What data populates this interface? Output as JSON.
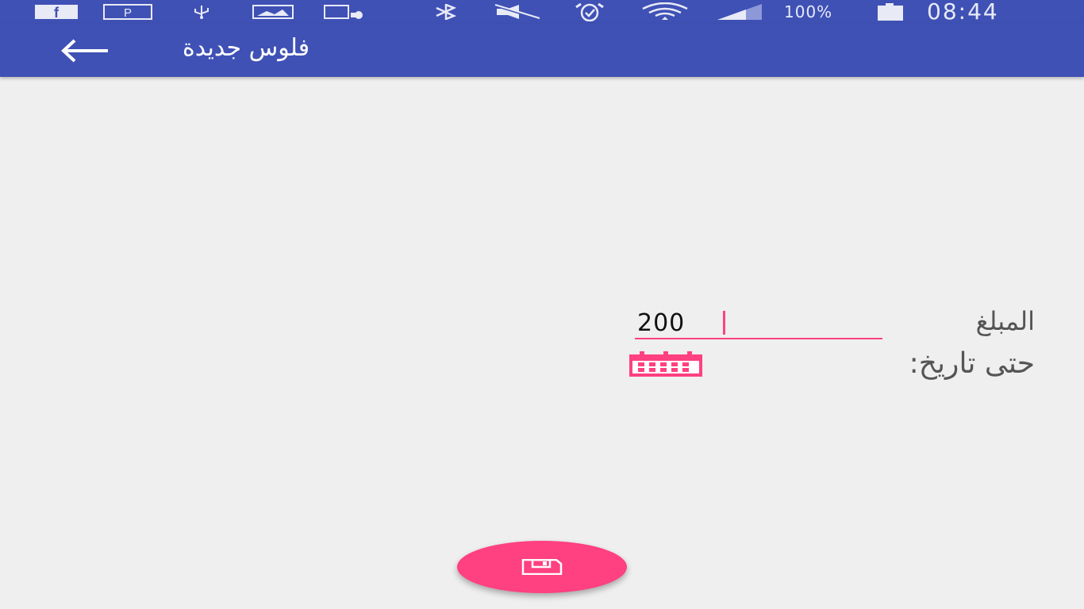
{
  "status_bar": {
    "battery_percent": "100%",
    "time": "08:44",
    "icons": [
      "facebook-icon",
      "pinterest-icon",
      "usb-icon",
      "image-icon",
      "cast-icon",
      "bluetooth-icon",
      "mute-icon",
      "alarm-icon",
      "wifi-icon",
      "signal-icon",
      "battery-icon"
    ]
  },
  "app_bar": {
    "title": "فلوس جديدة",
    "back_icon": "arrow-left-icon"
  },
  "form": {
    "amount_label": "المبلغ",
    "amount_value": "200",
    "date_label": "حتى تاريخ:",
    "calendar_icon": "calendar-icon"
  },
  "fab": {
    "icon": "save-icon"
  },
  "colors": {
    "primary": "#3f51b5",
    "accent": "#ff4081",
    "background": "#efefef"
  }
}
